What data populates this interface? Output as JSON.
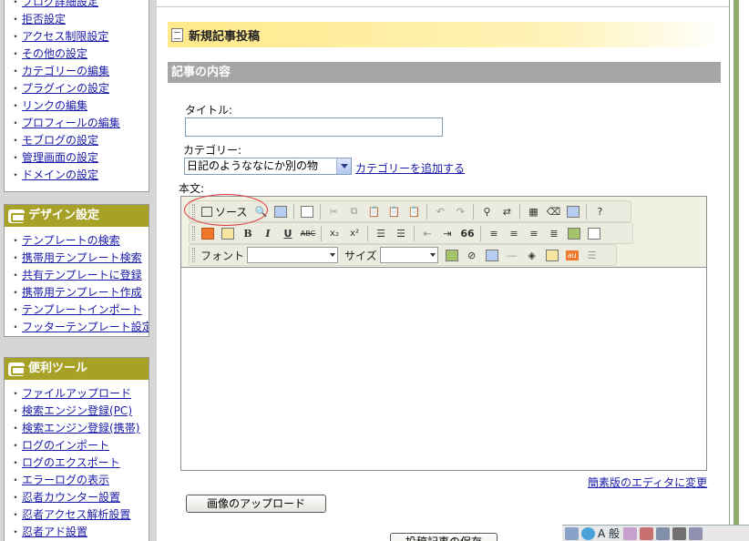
{
  "sidebar": {
    "box1_items": [
      "ブログ詳細設定",
      "拒否設定",
      "アクセス制限設定",
      "その他の設定",
      "カテゴリーの編集",
      "プラグインの設定",
      "リンクの編集",
      "プロフィールの編集",
      "モブログの設定",
      "管理画面の設定",
      "ドメインの設定"
    ],
    "design_title": "デザイン設定",
    "design_items": [
      "テンプレートの検索",
      "携帯用テンプレート検索",
      "共有テンプレートに登録",
      "携帯用テンプレート作成",
      "テンプレートインポート",
      "フッターテンプレート設定"
    ],
    "tools_title": "便利ツール",
    "tools_items": [
      "ファイルアップロード",
      "検索エンジン登録(PC)",
      "検索エンジン登録(携帯)",
      "ログのインポート",
      "ログのエクスポート",
      "エラーログの表示",
      "忍者カウンター設置",
      "忍者アクセス解析設置",
      "忍者アド設置"
    ]
  },
  "main": {
    "new_post_title": "新規記事投稿",
    "content_header": "記事の内容",
    "title_label": "タイトル:",
    "title_value": "",
    "category_label": "カテゴリー:",
    "category_selected": "日記のようななにか別の物",
    "add_category_link": "カテゴリーを追加する",
    "body_label": "本文:",
    "simple_editor_link": "簡素版のエディタに変更",
    "upload_button": "画像のアップロード",
    "save_button": "投稿記事の保存"
  },
  "editor": {
    "source_button": "ソース",
    "font_label": "フォント",
    "size_label": "サイズ",
    "font_value": "",
    "size_value": "",
    "bold": "B",
    "italic": "I",
    "underline": "U",
    "strike": "ABC",
    "subscript": "x₂",
    "superscript": "x²",
    "blockquote": "66",
    "help": "?",
    "mobile_emoji": "au"
  },
  "taskbar": {
    "ime_label": "A 般"
  },
  "colors": {
    "sidebar_header": "#a7a128",
    "link": "#1a1aa8",
    "highlight_circle": "#e03030",
    "post_bar": "#ffe98a"
  }
}
